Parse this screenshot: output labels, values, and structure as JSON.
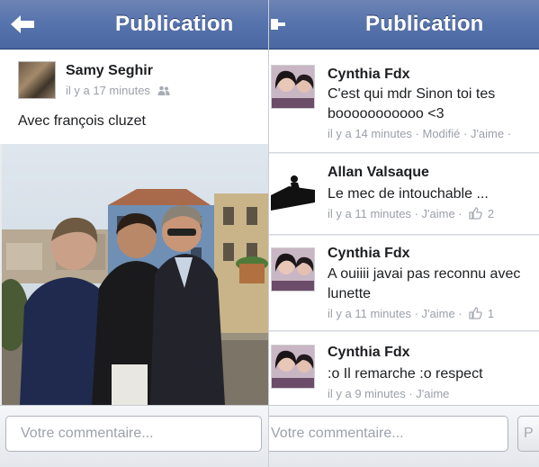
{
  "left": {
    "nav_title": "Publication",
    "post": {
      "author": "Samy Seghir",
      "time": "il y a 17 minutes",
      "text": "Avec françois cluzet"
    },
    "comment_placeholder": "Votre commentaire..."
  },
  "right": {
    "nav_title": "Publication",
    "comments": [
      {
        "author": "Cynthia Fdx",
        "lines": [
          "C'est qui mdr Sinon toi tes",
          "booooooooooo <3"
        ],
        "meta": "il y a 14 minutes · Modifié · J'aime ·"
      },
      {
        "author": "Allan Valsaque",
        "lines": [
          "Le mec de intouchable ..."
        ],
        "meta": "il y a 11 minutes · J'aime ·",
        "likes": "2"
      },
      {
        "author": "Cynthia Fdx",
        "lines": [
          "A ouiiii javai pas reconnu avec",
          "lunette"
        ],
        "meta": "il y a 11 minutes · J'aime ·",
        "likes": "1"
      },
      {
        "author": "Cynthia Fdx",
        "lines": [
          ":o Il remarche :o respect"
        ],
        "meta": "il y a 9 minutes · J'aime"
      }
    ],
    "comment_placeholder": "Votre commentaire...",
    "publish_label": "P"
  },
  "colors": {
    "navbar": "#5874ad",
    "meta_text": "#9ba0a9"
  }
}
